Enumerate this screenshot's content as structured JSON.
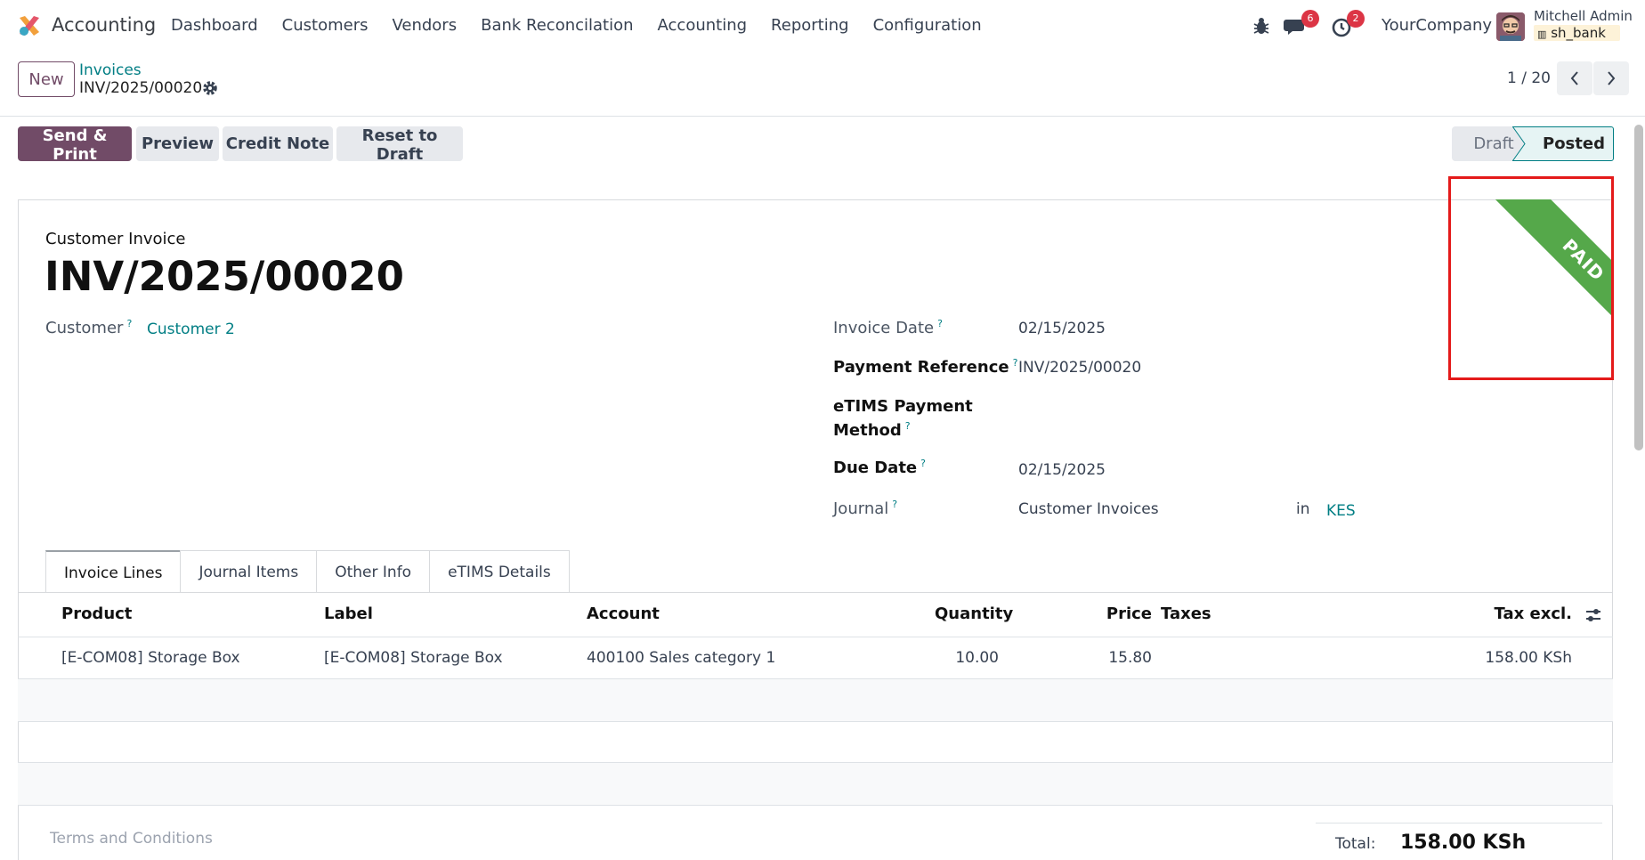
{
  "navbar": {
    "app_name": "Accounting",
    "menu": [
      "Dashboard",
      "Customers",
      "Vendors",
      "Bank Reconcilation",
      "Accounting",
      "Reporting",
      "Configuration"
    ],
    "messages_count": "6",
    "activities_count": "2",
    "company": "YourCompany",
    "user_name": "Mitchell Admin",
    "database": "sh_bank"
  },
  "control_panel": {
    "new_label": "New",
    "breadcrumb_parent": "Invoices",
    "breadcrumb_current": "INV/2025/00020",
    "pager": "1 / 20"
  },
  "actions": {
    "send_print": "Send & Print",
    "preview": "Preview",
    "credit_note": "Credit Note",
    "reset_draft": "Reset to Draft"
  },
  "statusbar": {
    "draft": "Draft",
    "posted": "Posted"
  },
  "ribbon": "PAID",
  "invoice": {
    "type": "Customer Invoice",
    "name": "INV/2025/00020",
    "customer_label": "Customer",
    "customer": "Customer 2",
    "invoice_date_label": "Invoice Date",
    "invoice_date": "02/15/2025",
    "payment_ref_label": "Payment Reference",
    "payment_ref": "INV/2025/00020",
    "etims_label_1": "eTIMS Payment",
    "etims_label_2": "Method",
    "due_date_label": "Due Date",
    "due_date": "02/15/2025",
    "journal_label": "Journal",
    "journal": "Customer Invoices",
    "in_label": "in",
    "currency": "KES",
    "help_mark": "?"
  },
  "tabs": [
    "Invoice Lines",
    "Journal Items",
    "Other Info",
    "eTIMS Details"
  ],
  "table": {
    "headers": {
      "product": "Product",
      "label": "Label",
      "account": "Account",
      "quantity": "Quantity",
      "price": "Price",
      "taxes": "Taxes",
      "tax_excl": "Tax excl."
    },
    "rows": [
      {
        "product": "[E-COM08] Storage Box",
        "label": "[E-COM08] Storage Box",
        "account": "400100 Sales category 1",
        "quantity": "10.00",
        "price": "15.80",
        "taxes": "",
        "subtotal": "158.00 KSh"
      }
    ]
  },
  "footer": {
    "terms_placeholder": "Terms and Conditions",
    "total_label": "Total:",
    "total_value": "158.00 KSh"
  }
}
